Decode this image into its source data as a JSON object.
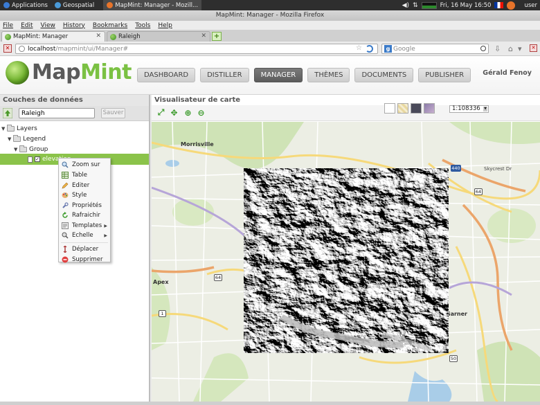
{
  "os_panel": {
    "applications": "Applications",
    "geospatial": "Geospatial",
    "window_title": "MapMint: Manager - Mozill...",
    "datetime": "Fri, 16 May  16:50",
    "user": "user"
  },
  "browser": {
    "title": "MapMint: Manager - Mozilla Firefox",
    "menu": [
      "File",
      "Edit",
      "View",
      "History",
      "Bookmarks",
      "Tools",
      "Help"
    ],
    "tabs": [
      {
        "label": "MapMint: Manager"
      },
      {
        "label": "Raleigh"
      }
    ],
    "url_host": "localhost",
    "url_path": "/mapmint/ui/Manager#",
    "search_placeholder": "Google"
  },
  "app": {
    "logo_map": "Map",
    "logo_mint": "Mint",
    "nav": [
      "DASHBOARD",
      "DISTILLER",
      "MANAGER",
      "THÈMES",
      "DOCUMENTS",
      "PUBLISHER"
    ],
    "active_nav": "MANAGER",
    "user_name": "Gérald Fenoy",
    "accent_color": "#7bc143"
  },
  "left_panel": {
    "title": "Couches de données",
    "map_name": "Raleigh",
    "save_label": "Sauver",
    "tree": {
      "root": "Layers",
      "legend": "Legend",
      "group": "Group",
      "layer": "elevation"
    }
  },
  "context_menu": {
    "items": [
      "Zoom sur",
      "Table",
      "Editer",
      "Style",
      "Propriétés",
      "Rafraichir",
      "Templates",
      "Echelle",
      "Déplacer",
      "Supprimer"
    ]
  },
  "map_panel": {
    "title": "Visualisateur de carte",
    "scale": "1:108336",
    "places": {
      "morrisville": "Morrisville",
      "apex": "Apex",
      "garner": "Garner",
      "skycrest": "Skycrest Dr",
      "route64a": "64",
      "route64b": "64",
      "route1": "1",
      "route50": "50",
      "route440": "440"
    }
  }
}
